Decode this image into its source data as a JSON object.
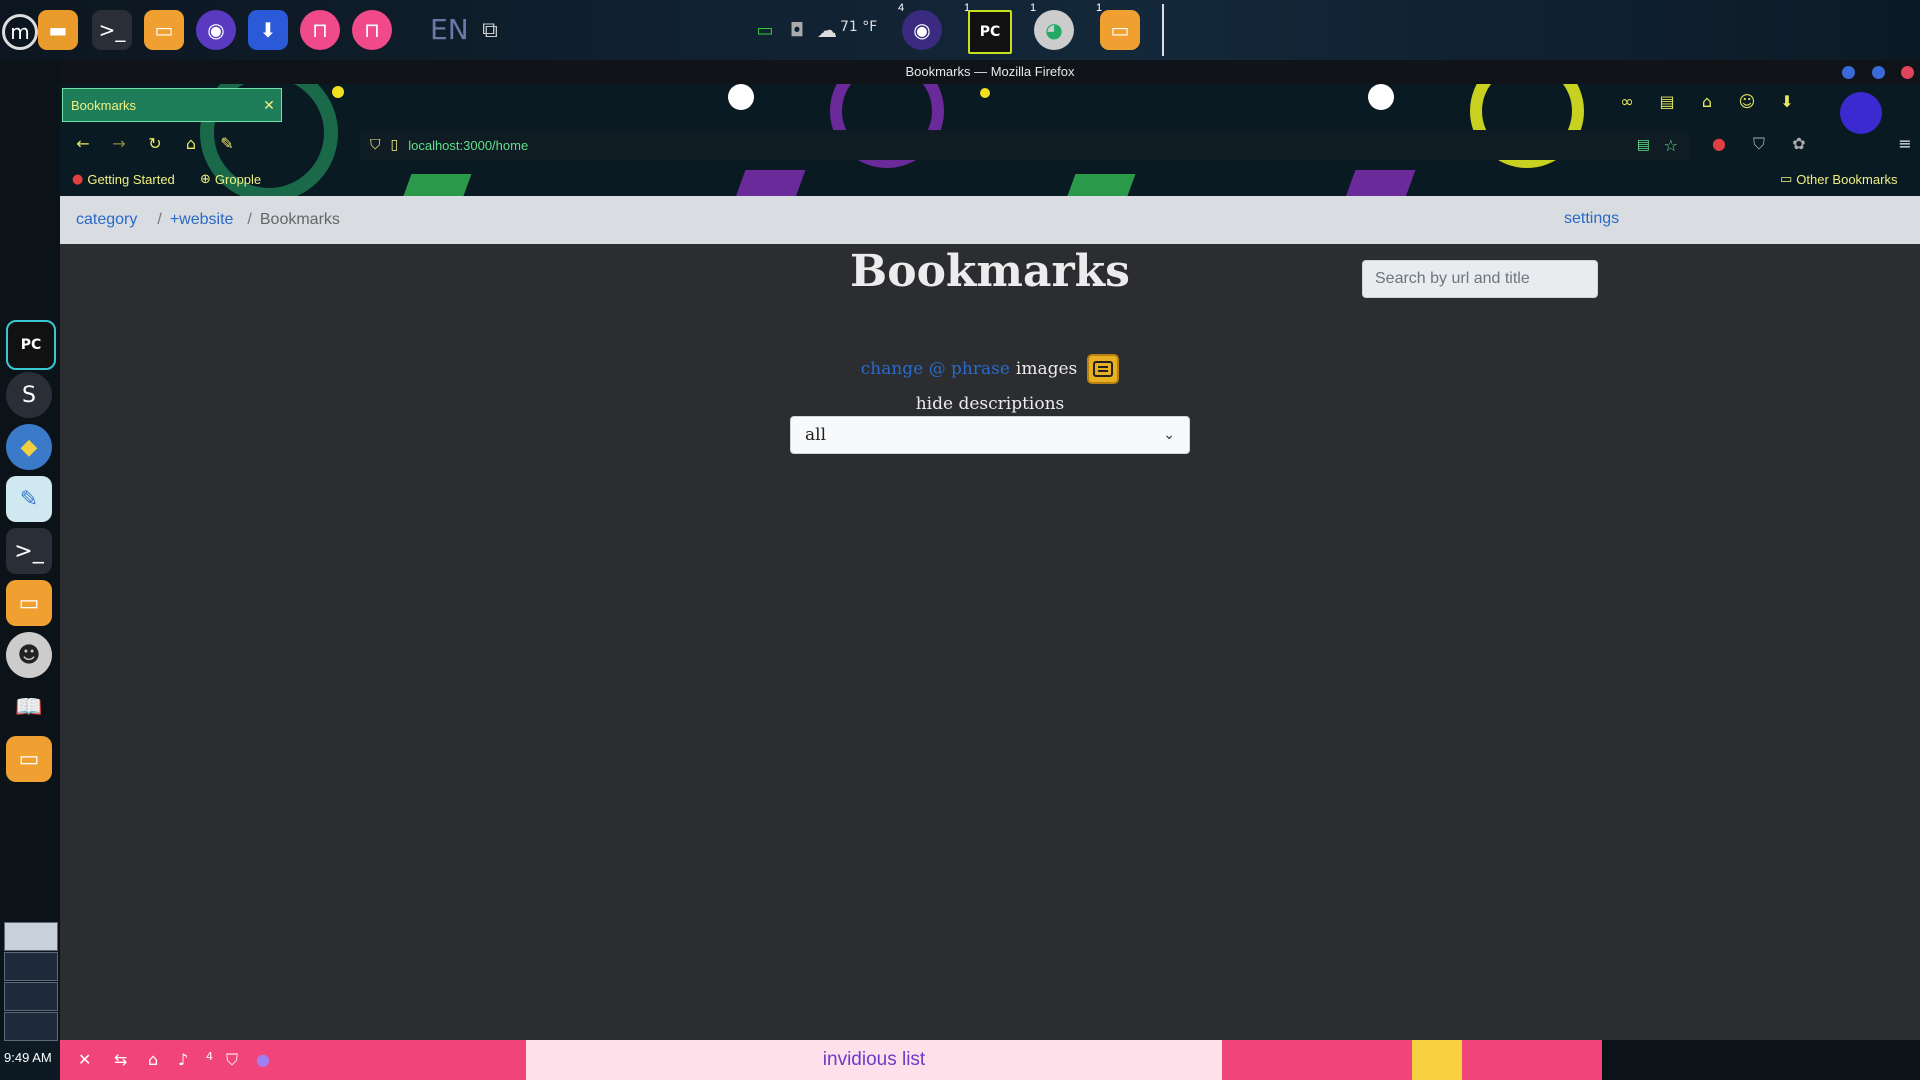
{
  "top_panel": {
    "language": "EN",
    "weather": "71 °F",
    "workspace_badges": [
      "4",
      "1",
      "1",
      "1"
    ]
  },
  "window": {
    "title": "Bookmarks — Mozilla Firefox"
  },
  "browser": {
    "tab_title": "Bookmarks",
    "url": "localhost:3000/home",
    "bookmarks_bar": {
      "items": [
        "Getting Started",
        "Gropple"
      ],
      "other": "Other Bookmarks"
    }
  },
  "page": {
    "breadcrumb": {
      "category": "category",
      "website": "+website",
      "current": "Bookmarks"
    },
    "settings_label": "settings",
    "search_placeholder": "Search by url and title",
    "title": "Bookmarks",
    "change_phrase_label": "change @ phrase",
    "images_label": "images",
    "hide_descriptions_label": "hide descriptions",
    "filter_selected": "all"
  },
  "taskbar": {
    "window_title": "invidious list",
    "clock": "9:49 AM",
    "notification_count": "4"
  },
  "colors": {
    "accent_link": "#2a6ac8",
    "toggle_yellow": "#e8b020",
    "taskbar_pink": "#f0447a"
  }
}
